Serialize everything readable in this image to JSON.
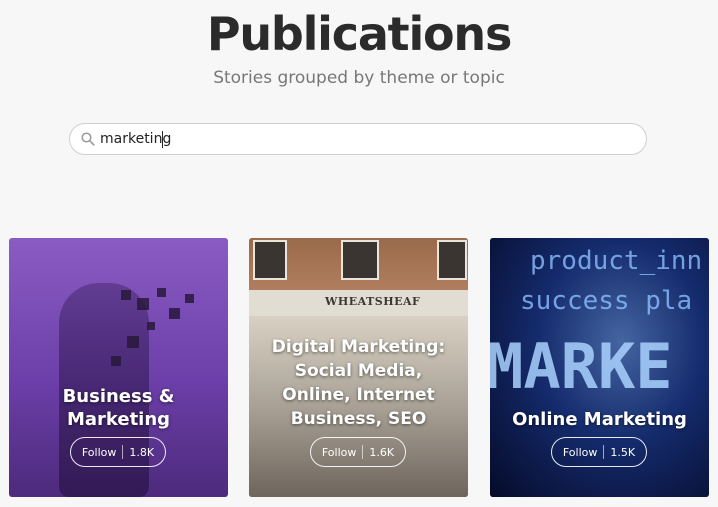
{
  "header": {
    "title": "Publications",
    "subtitle": "Stories grouped by theme or topic"
  },
  "search": {
    "value": "marketing",
    "icon": "search-icon"
  },
  "cards": [
    {
      "title_lines": [
        "Business &",
        "Marketing"
      ],
      "follow_label": "Follow",
      "follower_count": "1.8K",
      "accent": "#6c3fa9"
    },
    {
      "title_lines": [
        "Digital Marketing:",
        "Social Media,",
        "Online, Internet",
        "Business, SEO"
      ],
      "sign_text": "WHEATSHEAF",
      "follow_label": "Follow",
      "follower_count": "1.6K"
    },
    {
      "title_lines": [
        "Online Marketing"
      ],
      "screen_words": [
        "product_inn",
        "success pla",
        "MARKE"
      ],
      "follow_label": "Follow",
      "follower_count": "1.5K",
      "accent": "#06112e"
    }
  ]
}
